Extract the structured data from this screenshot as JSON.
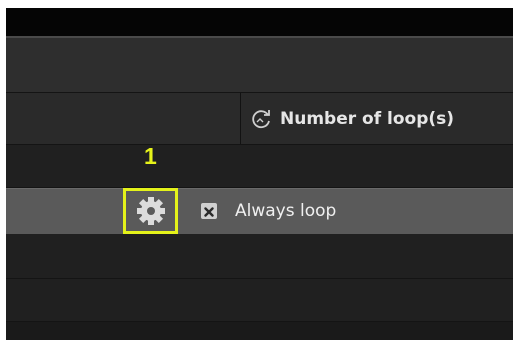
{
  "table": {
    "loop_column_header": "Number of loop(s)",
    "loop_option_label": "Always loop"
  },
  "annotation": {
    "step_number": "1",
    "highlight_color": "#e4f21a"
  },
  "icons": {
    "loop_header_icon": "loop-icon",
    "settings_icon": "gear-icon",
    "checkbox_icon": "close-icon"
  }
}
